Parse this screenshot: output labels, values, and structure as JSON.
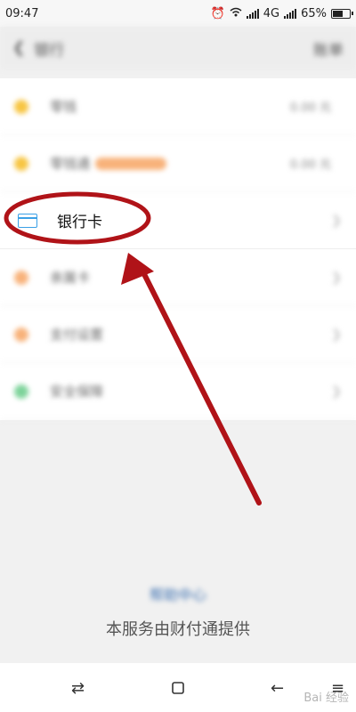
{
  "status_bar": {
    "time": "09:47",
    "network": "4G",
    "battery": "65%",
    "battery_level": 0.65
  },
  "header": {
    "back_icon": "chevron-left-icon",
    "title": "银行",
    "right_link": "账单"
  },
  "list": [
    {
      "icon": "yellow-dot-icon",
      "color": "#f7c542",
      "label": "零钱",
      "value": "0.00 元"
    },
    {
      "icon": "yellow-dot-icon",
      "color": "#f7c542",
      "label": "零钱通",
      "value": "0.00 元",
      "has_tag": true
    },
    {
      "icon": "bank-card-icon",
      "color": "#3aa0e6",
      "label": "银行卡",
      "highlight": true
    },
    {
      "icon": "orange-dot-icon",
      "color": "#f8b27a",
      "label": "亲属卡"
    },
    {
      "icon": "orange-dot-icon",
      "color": "#f8b27a",
      "label": "支付设置"
    },
    {
      "icon": "green-dot-icon",
      "color": "#7dd39a",
      "label": "安全保障"
    }
  ],
  "footer": {
    "help_link": "帮助中心",
    "provider_text": "本服务由财付通提供"
  },
  "nav_bar": {
    "icons": [
      "swap-icon",
      "square-icon",
      "back-arrow-icon",
      "menu-icon"
    ]
  },
  "watermark": "Bai 经验",
  "annotation": {
    "color": "#b01318"
  }
}
